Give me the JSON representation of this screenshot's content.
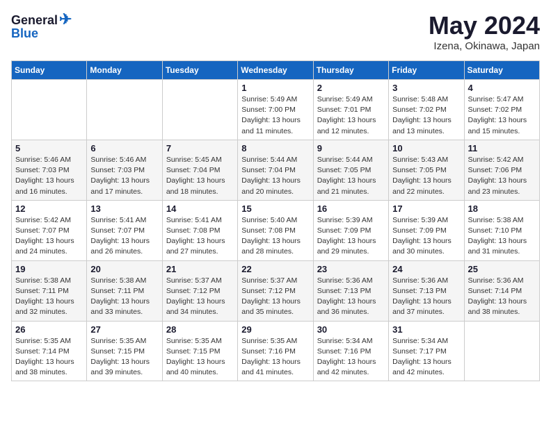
{
  "header": {
    "logo_general": "General",
    "logo_blue": "Blue",
    "month_title": "May 2024",
    "location": "Izena, Okinawa, Japan"
  },
  "weekdays": [
    "Sunday",
    "Monday",
    "Tuesday",
    "Wednesday",
    "Thursday",
    "Friday",
    "Saturday"
  ],
  "weeks": [
    [
      {
        "day": "",
        "info": ""
      },
      {
        "day": "",
        "info": ""
      },
      {
        "day": "",
        "info": ""
      },
      {
        "day": "1",
        "info": "Sunrise: 5:49 AM\nSunset: 7:00 PM\nDaylight: 13 hours\nand 11 minutes."
      },
      {
        "day": "2",
        "info": "Sunrise: 5:49 AM\nSunset: 7:01 PM\nDaylight: 13 hours\nand 12 minutes."
      },
      {
        "day": "3",
        "info": "Sunrise: 5:48 AM\nSunset: 7:02 PM\nDaylight: 13 hours\nand 13 minutes."
      },
      {
        "day": "4",
        "info": "Sunrise: 5:47 AM\nSunset: 7:02 PM\nDaylight: 13 hours\nand 15 minutes."
      }
    ],
    [
      {
        "day": "5",
        "info": "Sunrise: 5:46 AM\nSunset: 7:03 PM\nDaylight: 13 hours\nand 16 minutes."
      },
      {
        "day": "6",
        "info": "Sunrise: 5:46 AM\nSunset: 7:03 PM\nDaylight: 13 hours\nand 17 minutes."
      },
      {
        "day": "7",
        "info": "Sunrise: 5:45 AM\nSunset: 7:04 PM\nDaylight: 13 hours\nand 18 minutes."
      },
      {
        "day": "8",
        "info": "Sunrise: 5:44 AM\nSunset: 7:04 PM\nDaylight: 13 hours\nand 20 minutes."
      },
      {
        "day": "9",
        "info": "Sunrise: 5:44 AM\nSunset: 7:05 PM\nDaylight: 13 hours\nand 21 minutes."
      },
      {
        "day": "10",
        "info": "Sunrise: 5:43 AM\nSunset: 7:05 PM\nDaylight: 13 hours\nand 22 minutes."
      },
      {
        "day": "11",
        "info": "Sunrise: 5:42 AM\nSunset: 7:06 PM\nDaylight: 13 hours\nand 23 minutes."
      }
    ],
    [
      {
        "day": "12",
        "info": "Sunrise: 5:42 AM\nSunset: 7:07 PM\nDaylight: 13 hours\nand 24 minutes."
      },
      {
        "day": "13",
        "info": "Sunrise: 5:41 AM\nSunset: 7:07 PM\nDaylight: 13 hours\nand 26 minutes."
      },
      {
        "day": "14",
        "info": "Sunrise: 5:41 AM\nSunset: 7:08 PM\nDaylight: 13 hours\nand 27 minutes."
      },
      {
        "day": "15",
        "info": "Sunrise: 5:40 AM\nSunset: 7:08 PM\nDaylight: 13 hours\nand 28 minutes."
      },
      {
        "day": "16",
        "info": "Sunrise: 5:39 AM\nSunset: 7:09 PM\nDaylight: 13 hours\nand 29 minutes."
      },
      {
        "day": "17",
        "info": "Sunrise: 5:39 AM\nSunset: 7:09 PM\nDaylight: 13 hours\nand 30 minutes."
      },
      {
        "day": "18",
        "info": "Sunrise: 5:38 AM\nSunset: 7:10 PM\nDaylight: 13 hours\nand 31 minutes."
      }
    ],
    [
      {
        "day": "19",
        "info": "Sunrise: 5:38 AM\nSunset: 7:11 PM\nDaylight: 13 hours\nand 32 minutes."
      },
      {
        "day": "20",
        "info": "Sunrise: 5:38 AM\nSunset: 7:11 PM\nDaylight: 13 hours\nand 33 minutes."
      },
      {
        "day": "21",
        "info": "Sunrise: 5:37 AM\nSunset: 7:12 PM\nDaylight: 13 hours\nand 34 minutes."
      },
      {
        "day": "22",
        "info": "Sunrise: 5:37 AM\nSunset: 7:12 PM\nDaylight: 13 hours\nand 35 minutes."
      },
      {
        "day": "23",
        "info": "Sunrise: 5:36 AM\nSunset: 7:13 PM\nDaylight: 13 hours\nand 36 minutes."
      },
      {
        "day": "24",
        "info": "Sunrise: 5:36 AM\nSunset: 7:13 PM\nDaylight: 13 hours\nand 37 minutes."
      },
      {
        "day": "25",
        "info": "Sunrise: 5:36 AM\nSunset: 7:14 PM\nDaylight: 13 hours\nand 38 minutes."
      }
    ],
    [
      {
        "day": "26",
        "info": "Sunrise: 5:35 AM\nSunset: 7:14 PM\nDaylight: 13 hours\nand 38 minutes."
      },
      {
        "day": "27",
        "info": "Sunrise: 5:35 AM\nSunset: 7:15 PM\nDaylight: 13 hours\nand 39 minutes."
      },
      {
        "day": "28",
        "info": "Sunrise: 5:35 AM\nSunset: 7:15 PM\nDaylight: 13 hours\nand 40 minutes."
      },
      {
        "day": "29",
        "info": "Sunrise: 5:35 AM\nSunset: 7:16 PM\nDaylight: 13 hours\nand 41 minutes."
      },
      {
        "day": "30",
        "info": "Sunrise: 5:34 AM\nSunset: 7:16 PM\nDaylight: 13 hours\nand 42 minutes."
      },
      {
        "day": "31",
        "info": "Sunrise: 5:34 AM\nSunset: 7:17 PM\nDaylight: 13 hours\nand 42 minutes."
      },
      {
        "day": "",
        "info": ""
      }
    ]
  ]
}
